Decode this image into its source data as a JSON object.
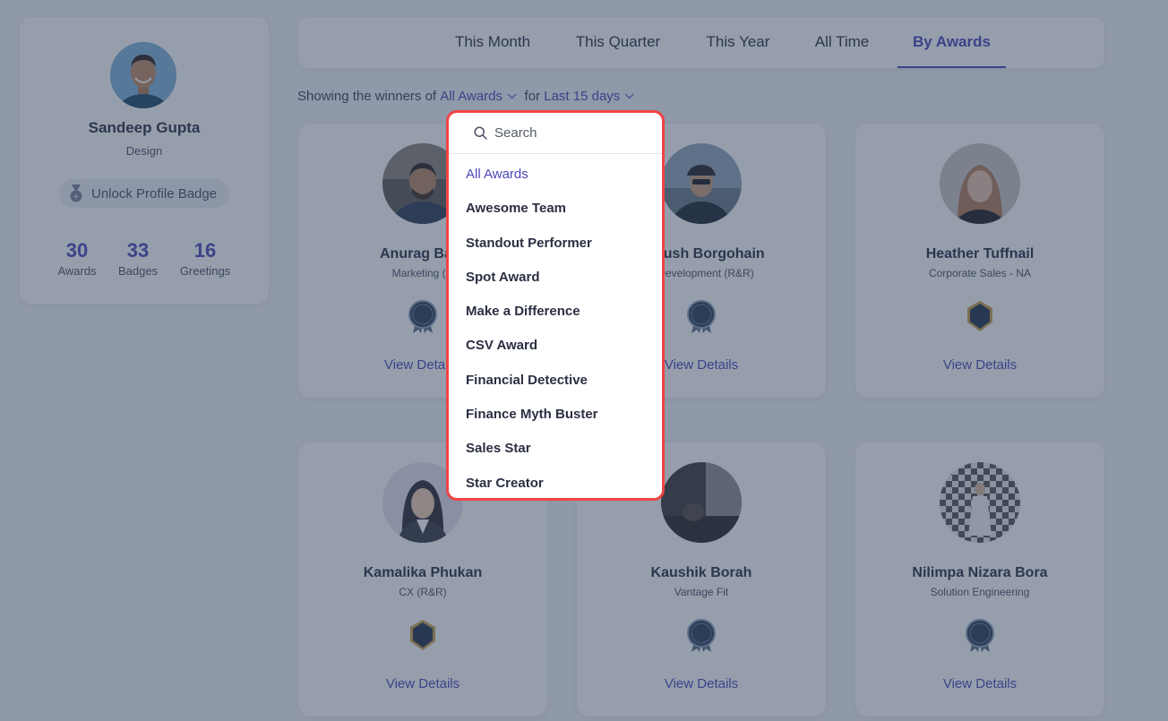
{
  "profile": {
    "name": "Sandeep Gupta",
    "department": "Design",
    "unlock_label": "Unlock Profile Badge",
    "stats": [
      {
        "value": "30",
        "label": "Awards"
      },
      {
        "value": "33",
        "label": "Badges"
      },
      {
        "value": "16",
        "label": "Greetings"
      }
    ]
  },
  "tabs": [
    {
      "label": "This Month",
      "active": false
    },
    {
      "label": "This Quarter",
      "active": false
    },
    {
      "label": "This Year",
      "active": false
    },
    {
      "label": "All Time",
      "active": false
    },
    {
      "label": "By Awards",
      "active": true
    }
  ],
  "filter": {
    "prefix": "Showing the winners of",
    "award_value": "All Awards",
    "connector": "for",
    "period_value": "Last 15 days"
  },
  "dropdown": {
    "search_placeholder": "Search",
    "items": [
      {
        "label": "All Awards",
        "selected": true
      },
      {
        "label": "Awesome Team"
      },
      {
        "label": "Standout Performer"
      },
      {
        "label": "Spot Award"
      },
      {
        "label": "Make a Difference"
      },
      {
        "label": "CSV Award"
      },
      {
        "label": "Financial Detective"
      },
      {
        "label": "Finance Myth Buster"
      },
      {
        "label": "Sales Star"
      },
      {
        "label": "Star Creator"
      }
    ]
  },
  "winners": [
    {
      "name": "Anurag Bark",
      "department": "Marketing (R",
      "badge": "spot-award-icon",
      "view_label": "View Deta"
    },
    {
      "name": "ngkush Borgohain",
      "department": "d Development (R&R)",
      "badge": "spot-award-icon",
      "view_label": "View Details"
    },
    {
      "name": "Heather Tuffnail",
      "department": "Corporate Sales - NA",
      "badge": "awesome-team-icon",
      "view_label": "View Details"
    },
    {
      "name": "Kamalika Phukan",
      "department": "CX (R&R)",
      "badge": "awesome-team-icon",
      "view_label": "View Details"
    },
    {
      "name": "Kaushik Borah",
      "department": "Vantage Fit",
      "badge": "spot-award-icon",
      "view_label": "View Details"
    },
    {
      "name": "Nilimpa Nizara Bora",
      "department": "Solution Engineering",
      "badge": "spot-award-icon",
      "view_label": "View Details"
    }
  ],
  "colors": {
    "accent": "#4b46b8",
    "dropdown_border": "#ef4444",
    "overlay": "#2e3e5a"
  }
}
